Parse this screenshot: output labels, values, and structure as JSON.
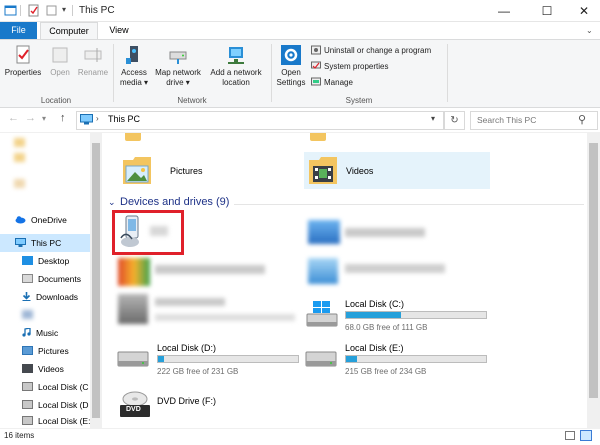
{
  "window": {
    "title": "This PC",
    "controls": {
      "minimize": "—",
      "maximize": "☐",
      "close": "✕"
    }
  },
  "ribbon": {
    "tabs": {
      "file": "File",
      "computer": "Computer",
      "view": "View"
    },
    "location": {
      "label": "Location",
      "properties": "Properties",
      "open": "Open",
      "rename": "Rename"
    },
    "network": {
      "label": "Network",
      "access_media": "Access media",
      "access_media_l1": "Access",
      "access_media_l2": "media ▾",
      "map_drive_l1": "Map network",
      "map_drive_l2": "drive ▾",
      "add_location_l1": "Add a network",
      "add_location_l2": "location"
    },
    "system": {
      "label": "System",
      "open_settings_l1": "Open",
      "open_settings_l2": "Settings",
      "uninstall": "Uninstall or change a program",
      "system_properties": "System properties",
      "manage": "Manage"
    }
  },
  "address_bar": {
    "path": "This PC",
    "search_placeholder": "Search This PC",
    "back": "←",
    "forward": "→",
    "recent": "▾",
    "up": "↑",
    "dropdown": "▾",
    "refresh": "↻",
    "search_glyph": "⚲"
  },
  "nav_pane": {
    "items": [
      {
        "label": ""
      },
      {
        "label": ""
      },
      {
        "label": ""
      },
      {
        "label": "OneDrive"
      },
      {
        "label": "This PC"
      },
      {
        "label": "Desktop"
      },
      {
        "label": "Documents"
      },
      {
        "label": "Downloads"
      },
      {
        "label": ""
      },
      {
        "label": "Music"
      },
      {
        "label": "Pictures"
      },
      {
        "label": "Videos"
      },
      {
        "label": "Local Disk (C"
      },
      {
        "label": "Local Disk (D"
      },
      {
        "label": "Local Disk (E:"
      }
    ]
  },
  "folders": {
    "pictures": "Pictures",
    "videos": "Videos"
  },
  "devices": {
    "header": "Devices and drives (9)",
    "chevron": "⌄",
    "drives": [
      {
        "name": "Local Disk (C:)",
        "free_text": "68.0 GB free of 111 GB",
        "used_fraction": 0.39
      },
      {
        "name": "Local Disk (D:)",
        "free_text": "222 GB free of 231 GB",
        "used_fraction": 0.04
      },
      {
        "name": "Local Disk (E:)",
        "free_text": "215 GB free of 234 GB",
        "used_fraction": 0.08
      },
      {
        "name": "DVD Drive (F:)"
      }
    ],
    "dvd_badge": "DVD"
  },
  "status": {
    "item_count": "16 items"
  },
  "colors": {
    "accent": "#1979ca",
    "drive_fill": "#26a0da",
    "highlight_box": "#e0202a",
    "selection": "#cce8ff"
  }
}
